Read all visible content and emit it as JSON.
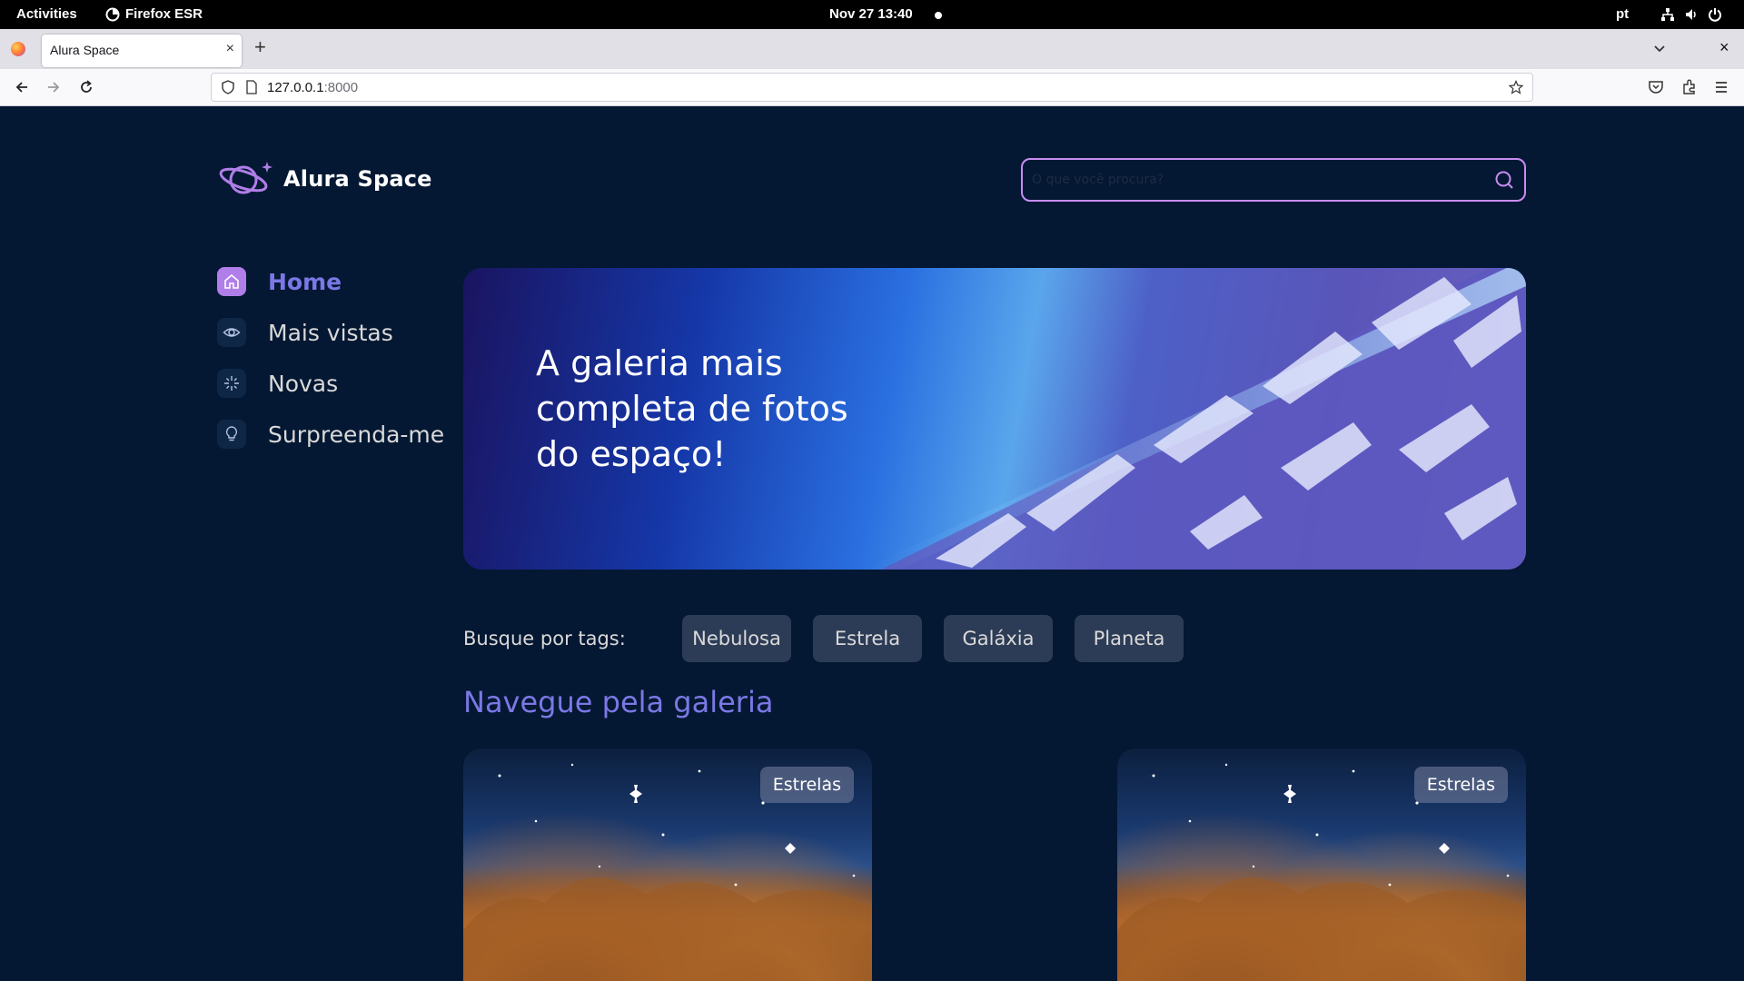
{
  "topbar": {
    "activities": "Activities",
    "app_name": "Firefox ESR",
    "clock": "Nov 27  13:40",
    "lang": "pt"
  },
  "browser": {
    "tab_title": "Alura Space",
    "tab_close": "×",
    "new_tab": "+",
    "window_close": "×",
    "url_host": "127.0.0.1",
    "url_port": ":8000"
  },
  "header": {
    "logo_text": "Alura Space",
    "search_placeholder": "O que você procura?"
  },
  "sidebar": {
    "items": [
      {
        "label": "Home",
        "icon": "home-icon",
        "active": true
      },
      {
        "label": "Mais vistas",
        "icon": "eye-icon",
        "active": false
      },
      {
        "label": "Novas",
        "icon": "sparkle-icon",
        "active": false
      },
      {
        "label": "Surpreenda-me",
        "icon": "lightbulb-icon",
        "active": false
      }
    ]
  },
  "banner": {
    "title": "A galeria mais completa de fotos do espaço!"
  },
  "tags": {
    "label": "Busque por tags:",
    "items": [
      "Nebulosa",
      "Estrela",
      "Galáxia",
      "Planeta"
    ]
  },
  "gallery": {
    "title": "Navegue pela galeria",
    "cards": [
      {
        "tag": "Estrelas"
      },
      {
        "tag": "Estrelas"
      }
    ]
  },
  "colors": {
    "page_bg": "#041833",
    "accent": "#7b78e5",
    "active_icon_bg": "#b07ee8",
    "search_border": "#c98cf1",
    "tag_bg": "#2d3c56",
    "text": "#d9d9d9"
  }
}
